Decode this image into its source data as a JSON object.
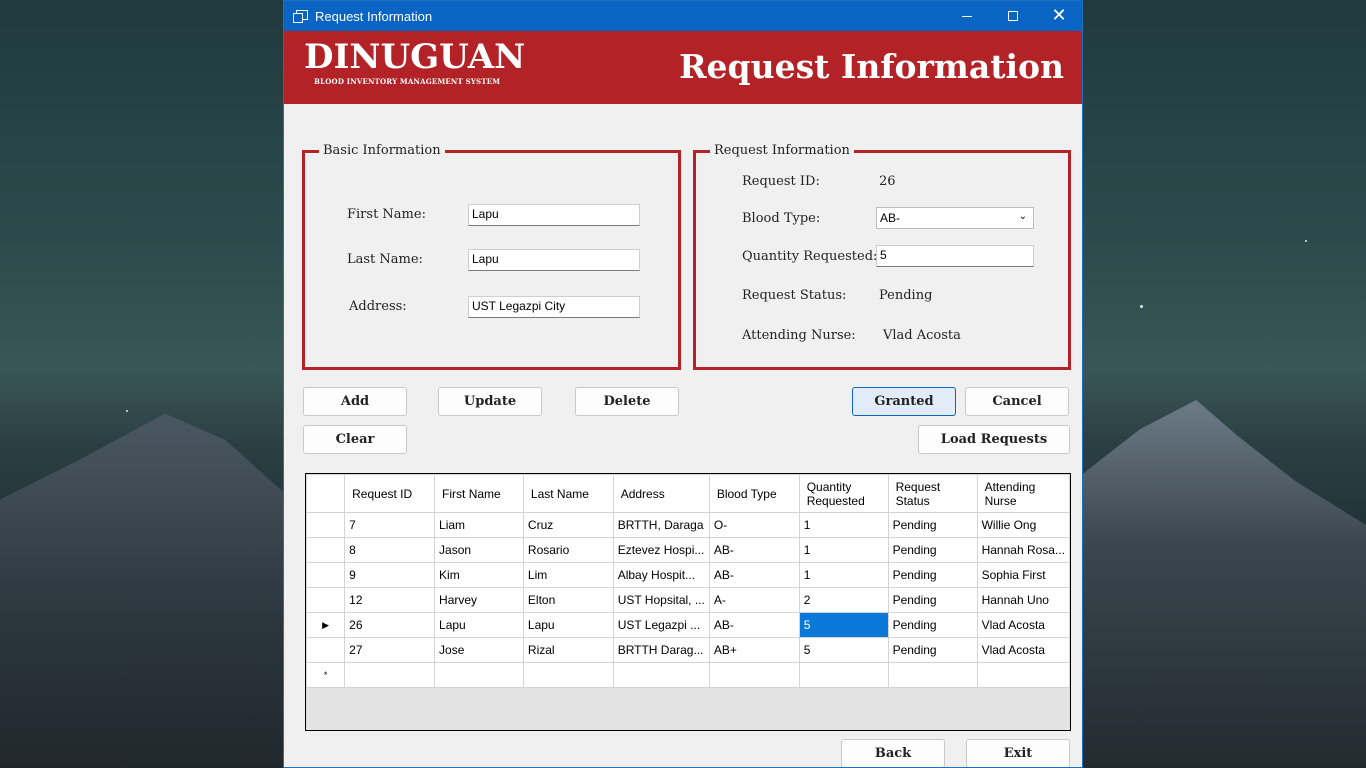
{
  "window": {
    "title": "Request Information"
  },
  "banner": {
    "brand": "DINUGUAN",
    "tagline": "BLOOD INVENTORY MANAGEMENT SYSTEM",
    "page_title": "Request Information"
  },
  "basic_info": {
    "legend": "Basic Information",
    "first_name_label": "First Name:",
    "first_name_value": "Lapu",
    "last_name_label": "Last Name:",
    "last_name_value": "Lapu",
    "address_label": "Address:",
    "address_value": "UST Legazpi City"
  },
  "request_info": {
    "legend": "Request Information",
    "request_id_label": "Request ID:",
    "request_id_value": "26",
    "blood_type_label": "Blood Type:",
    "blood_type_value": "AB-",
    "quantity_label": "Quantity Requested:",
    "quantity_value": "5",
    "status_label": "Request Status:",
    "status_value": "Pending",
    "nurse_label": "Attending Nurse:",
    "nurse_value": "Vlad Acosta"
  },
  "buttons": {
    "add": "Add",
    "update": "Update",
    "delete": "Delete",
    "clear": "Clear",
    "granted": "Granted",
    "cancel": "Cancel",
    "load_requests": "Load Requests",
    "back": "Back",
    "exit": "Exit"
  },
  "table": {
    "columns": [
      "Request ID",
      "First Name",
      "Last Name",
      "Address",
      "Blood Type",
      "Quantity Requested",
      "Request Status",
      "Attending Nurse"
    ],
    "rows": [
      [
        "7",
        "Liam",
        "Cruz",
        "BRTTH, Daraga",
        "O-",
        "1",
        "Pending",
        "Willie Ong"
      ],
      [
        "8",
        "Jason",
        "Rosario",
        "Eztevez Hospi...",
        "AB-",
        "1",
        "Pending",
        "Hannah Rosa..."
      ],
      [
        "9",
        "Kim",
        "Lim",
        "Albay Hospit...",
        "AB-",
        "1",
        "Pending",
        "Sophia First"
      ],
      [
        "12",
        "Harvey",
        "Elton",
        "UST Hopsital, ...",
        "A-",
        "2",
        "Pending",
        "Hannah Uno"
      ],
      [
        "26",
        "Lapu",
        "Lapu",
        "UST Legazpi ...",
        "AB-",
        "5",
        "Pending",
        "Vlad Acosta"
      ],
      [
        "27",
        "Jose",
        "Rizal",
        "BRTTH Darag...",
        "AB+",
        "5",
        "Pending",
        "Vlad Acosta"
      ]
    ],
    "current_row_marker": "▶",
    "new_row_marker": "*"
  },
  "colors": {
    "accent": "#b22226",
    "titlebar": "#0a64c4",
    "selection": "#0a78d7"
  }
}
